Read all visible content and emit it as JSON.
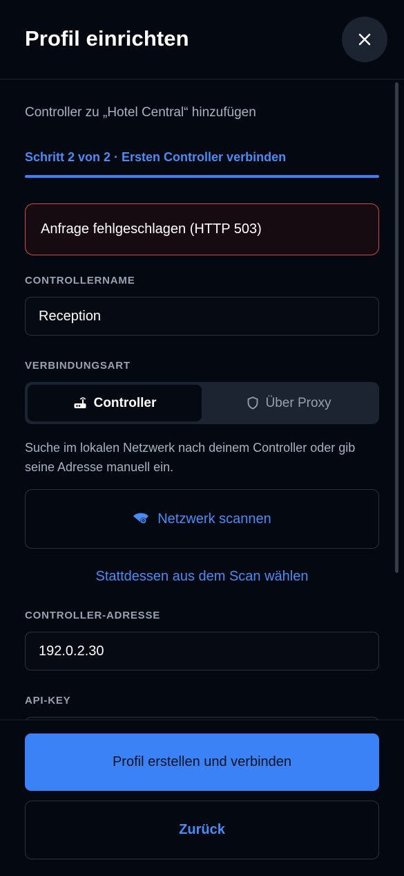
{
  "header": {
    "title": "Profil einrichten",
    "close_icon": "close-icon"
  },
  "form": {
    "subtitle": "Controller zu „Hotel Central“ hinzufügen",
    "step": "Schritt 2 von 2 · Ersten Controller verbinden",
    "error": "Anfrage fehlgeschlagen (HTTP 503)",
    "controller_name_label": "CONTROLLERNAME",
    "controller_name_value": "Reception",
    "connection_label": "VERBINDUNGSART",
    "connection_options": [
      {
        "label": "Controller",
        "icon": "router-icon",
        "selected": true
      },
      {
        "label": "Über Proxy",
        "icon": "shield-icon",
        "selected": false
      }
    ],
    "description": "Suche im lokalen Netzwerk nach deinem Controller oder gib seine Adresse manuell ein.",
    "scan_button": "Netzwerk scannen",
    "scan_link": "Stattdessen aus dem Scan wählen",
    "address_label": "CONTROLLER-ADRESSE",
    "address_value": "192.0.2.30",
    "api_key_label": "API-KEY"
  },
  "footer": {
    "primary": "Profil erstellen und verbinden",
    "secondary": "Zurück"
  },
  "colors": {
    "background": "#030811",
    "accent": "#3b82f6",
    "error_border": "#d04848"
  }
}
